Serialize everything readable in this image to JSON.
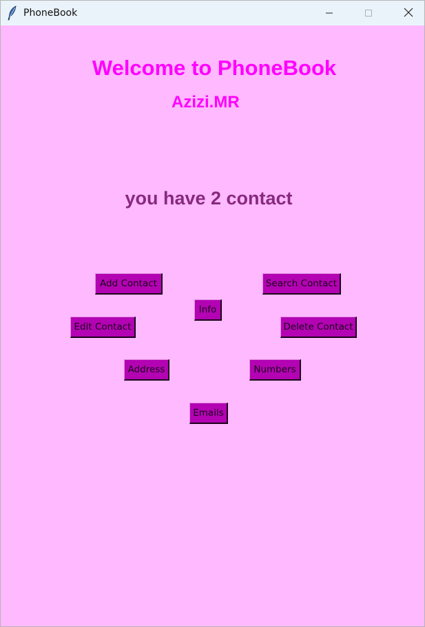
{
  "window": {
    "title": "PhoneBook"
  },
  "main": {
    "heading": "Welcome to PhoneBook",
    "author": "Azizi.MR",
    "contact_count_text": "you have 2 contact"
  },
  "buttons": {
    "add_contact": "Add Contact",
    "search_contact": "Search Contact",
    "info": "Info",
    "edit_contact": "Edit Contact",
    "delete_contact": "Delete Contact",
    "address": "Address",
    "numbers": "Numbers",
    "emails": "Emails"
  },
  "icons": {
    "app": "feather-icon",
    "minimize": "minimize-icon",
    "maximize": "maximize-icon",
    "close": "close-icon"
  },
  "colors": {
    "background": "#ffb9ff",
    "heading": "#ff00ff",
    "count_text": "#87297f",
    "button": "#b303b3",
    "titlebar": "#eaf3fa"
  }
}
